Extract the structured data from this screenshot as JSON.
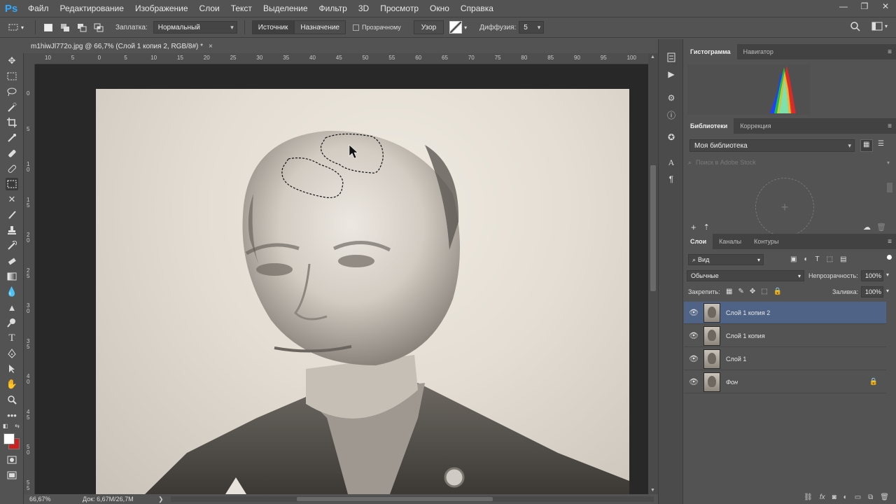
{
  "app": {
    "logo": "Ps"
  },
  "menu": [
    "Файл",
    "Редактирование",
    "Изображение",
    "Слои",
    "Текст",
    "Выделение",
    "Фильтр",
    "3D",
    "Просмотр",
    "Окно",
    "Справка"
  ],
  "window_controls": {
    "minimize": "—",
    "restore": "❐",
    "close": "✕"
  },
  "options": {
    "patch_label": "Заплатка:",
    "patch_mode": "Нормальный",
    "source_btn": "Источник",
    "dest_btn": "Назначение",
    "transparent_label": "Прозрачному",
    "pattern_btn": "Узор",
    "diffusion_label": "Диффузия:",
    "diffusion_value": "5"
  },
  "document": {
    "tab_title": "m1hiwJl772o.jpg @ 66,7% (Слой 1 копия 2, RGB/8#) *",
    "close": "×"
  },
  "ruler_top": [
    "10",
    "5",
    "0",
    "5",
    "10",
    "15",
    "20",
    "25",
    "30",
    "35",
    "40",
    "45",
    "50",
    "55",
    "60",
    "65",
    "70",
    "75",
    "80",
    "85",
    "90",
    "95",
    "100"
  ],
  "ruler_left": [
    "0",
    "5",
    "1 0",
    "1 5",
    "2 0",
    "2 5",
    "3 0",
    "3 5",
    "4 0",
    "4 5",
    "5 0",
    "5 5"
  ],
  "status": {
    "zoom": "66,67%",
    "doc": "Док: 6,67M/26,7M",
    "arrow": "❯"
  },
  "panels": {
    "top_tabs": [
      "Гистограмма",
      "Навигатор"
    ],
    "lib_tabs": [
      "Библиотеки",
      "Коррекция"
    ],
    "library_select": "Моя библиотека",
    "stock_search_placeholder": "Поиск в Adobe Stock",
    "layers_tabs": [
      "Слои",
      "Каналы",
      "Контуры"
    ],
    "filter_kind": "Вид",
    "blend_mode": "Обычные",
    "opacity_label": "Непрозрачность:",
    "opacity_value": "100%",
    "lock_label": "Закрепить:",
    "fill_label": "Заливка:",
    "fill_value": "100%",
    "layers": [
      {
        "name": "Слой 1 копия 2",
        "selected": true
      },
      {
        "name": "Слой 1 копия",
        "selected": false
      },
      {
        "name": "Слой 1",
        "selected": false
      },
      {
        "name": "Фон",
        "selected": false,
        "locked": true
      }
    ]
  },
  "colors": {
    "accent_blue": "#31a8ff",
    "selected_layer": "#4f6386",
    "bg_swatch": "#d01f1f"
  }
}
